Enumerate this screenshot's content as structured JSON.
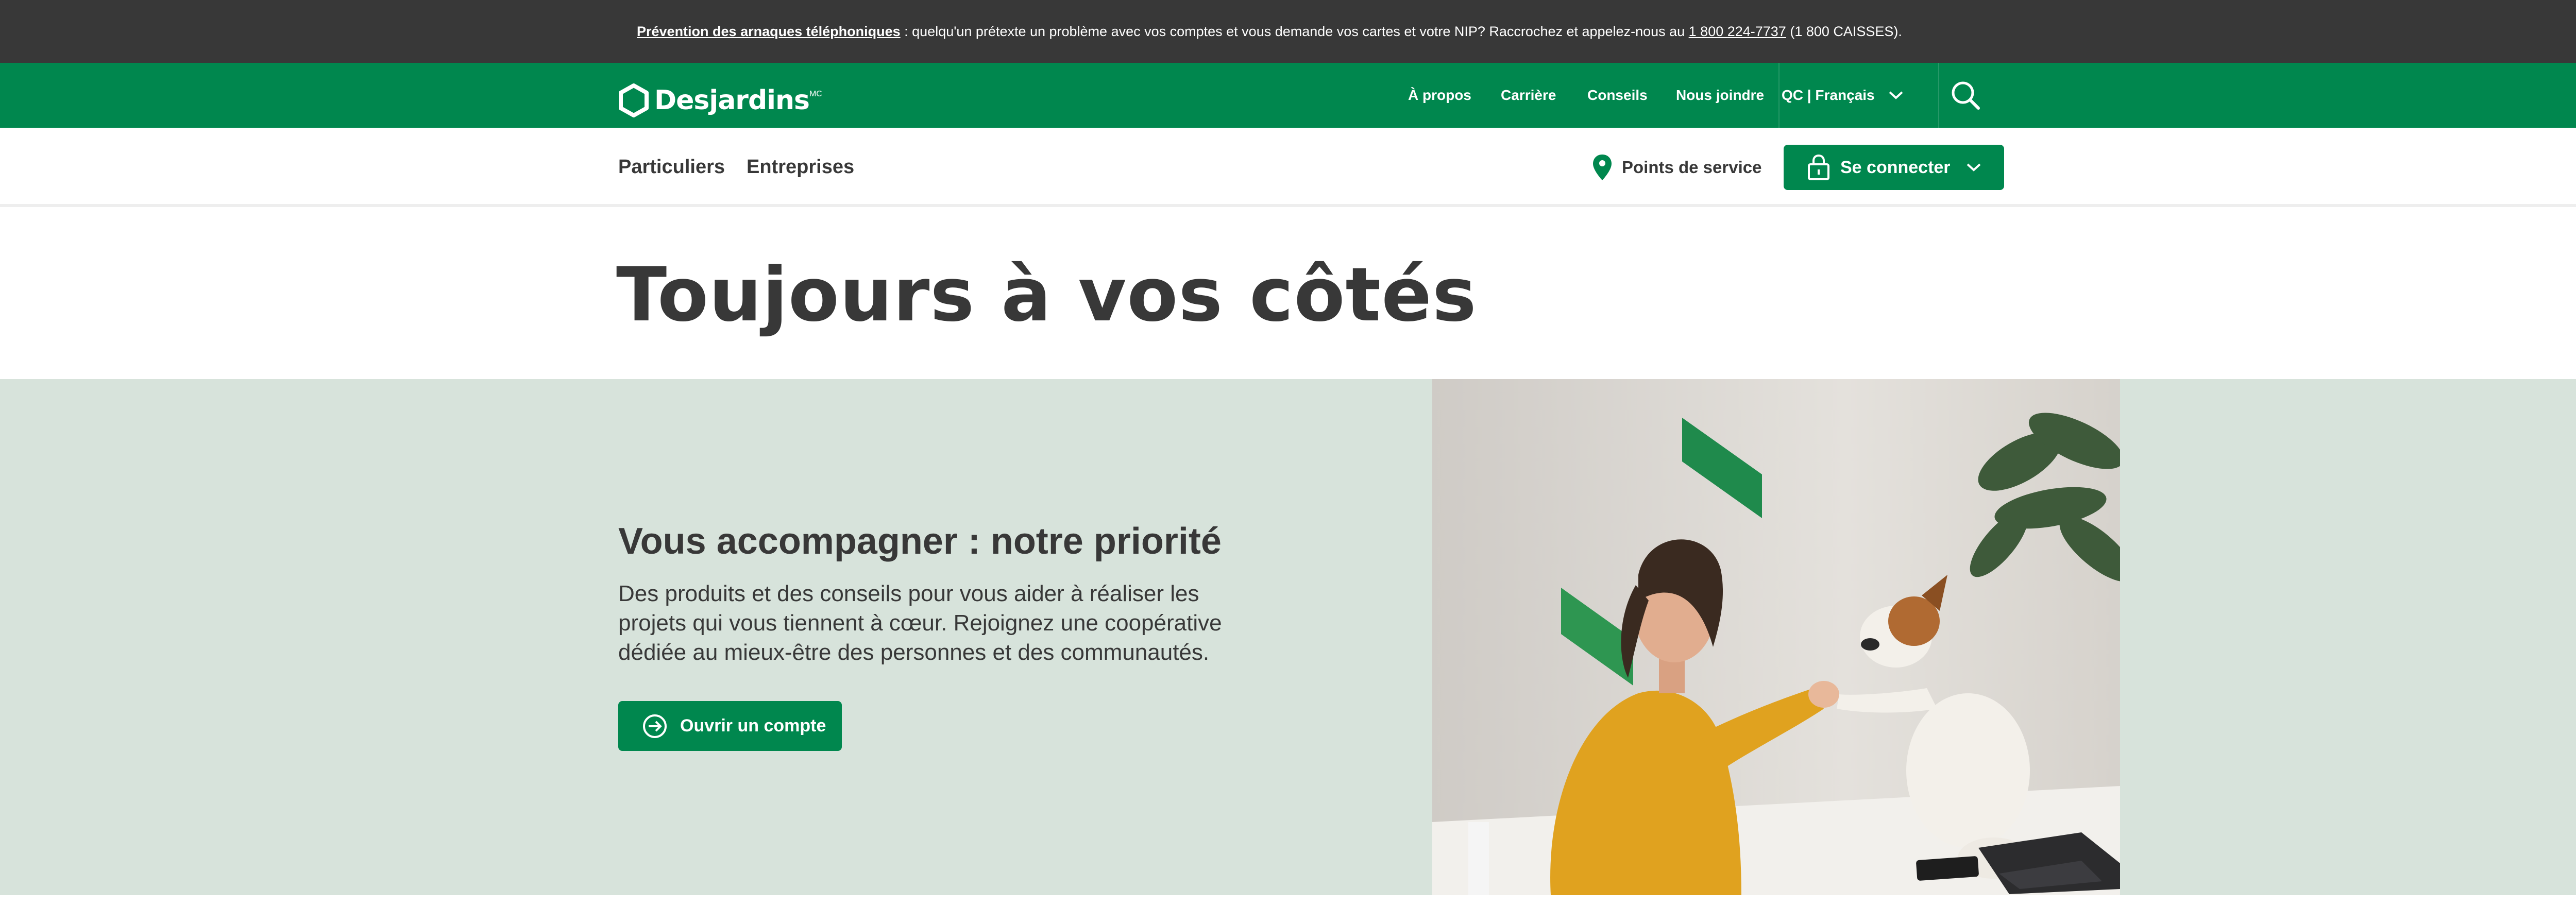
{
  "alert": {
    "link_text": "Prévention des arnaques téléphoniques",
    "message": " : quelqu'un prétexte un problème avec vos comptes et vous demande vos cartes et votre NIP? Raccrochez et appelez-nous au ",
    "phone": "1 800 224-7737",
    "phone_suffix": " (1 800 CAISSES)."
  },
  "brand": {
    "name": "Desjardins",
    "tm": "MC"
  },
  "topnav": {
    "items": [
      "À propos",
      "Carrière",
      "Conseils",
      "Nous joindre"
    ],
    "language": "QC | Français"
  },
  "mainnav": {
    "segments": [
      "Particuliers",
      "Entreprises"
    ],
    "points_label": "Points de service",
    "login_label": "Se connecter"
  },
  "hero": {
    "title": "Toujours à vos côtés"
  },
  "section": {
    "title": "Vous accompagner : notre priorité",
    "text": "Des produits et des conseils pour vous aider à réaliser les projets qui vous tiennent à cœur. Rejoignez une coopérative dédiée au mieux-être des personnes et des communautés.",
    "cta": "Ouvrir un compte"
  },
  "colors": {
    "brand_green": "#00874e",
    "alert_bg": "#383838",
    "section_bg": "#d7e3db",
    "text_dark": "#383838"
  },
  "icons": {
    "close": "close-icon",
    "search": "search-icon",
    "location": "map-pin-icon",
    "lock": "lock-icon",
    "chevron": "chevron-down-icon",
    "arrow": "arrow-circle-icon"
  }
}
